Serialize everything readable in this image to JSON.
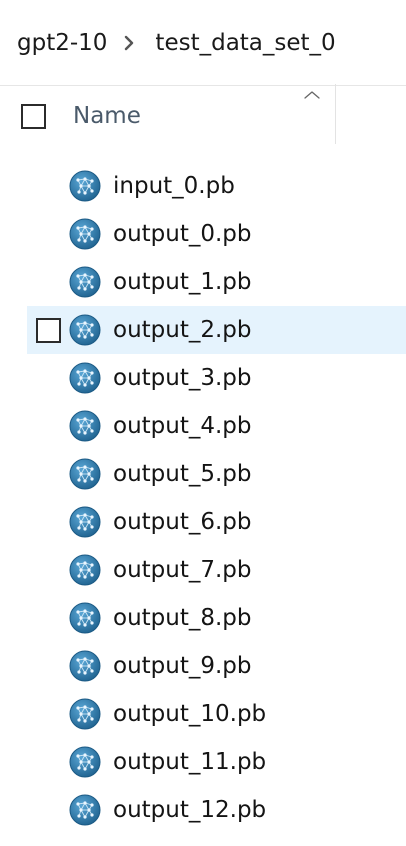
{
  "breadcrumb": {
    "items": [
      "gpt2-10",
      "test_data_set_0"
    ],
    "separator_icon": "chevron-right-icon"
  },
  "header": {
    "name_column": "Name",
    "sort_icon": "chevron-up-icon",
    "select_all_checked": false
  },
  "files": [
    {
      "name": "input_0.pb",
      "selected": false
    },
    {
      "name": "output_0.pb",
      "selected": false
    },
    {
      "name": "output_1.pb",
      "selected": false
    },
    {
      "name": "output_2.pb",
      "selected": true
    },
    {
      "name": "output_3.pb",
      "selected": false
    },
    {
      "name": "output_4.pb",
      "selected": false
    },
    {
      "name": "output_5.pb",
      "selected": false
    },
    {
      "name": "output_6.pb",
      "selected": false
    },
    {
      "name": "output_7.pb",
      "selected": false
    },
    {
      "name": "output_8.pb",
      "selected": false
    },
    {
      "name": "output_9.pb",
      "selected": false
    },
    {
      "name": "output_10.pb",
      "selected": false
    },
    {
      "name": "output_11.pb",
      "selected": false
    },
    {
      "name": "output_12.pb",
      "selected": false
    }
  ],
  "file_icon": "neural-network-file-icon",
  "colors": {
    "selection_bg": "#e5f3fd",
    "icon_blue": "#2f7fb0",
    "header_text": "#4a5a6a"
  }
}
